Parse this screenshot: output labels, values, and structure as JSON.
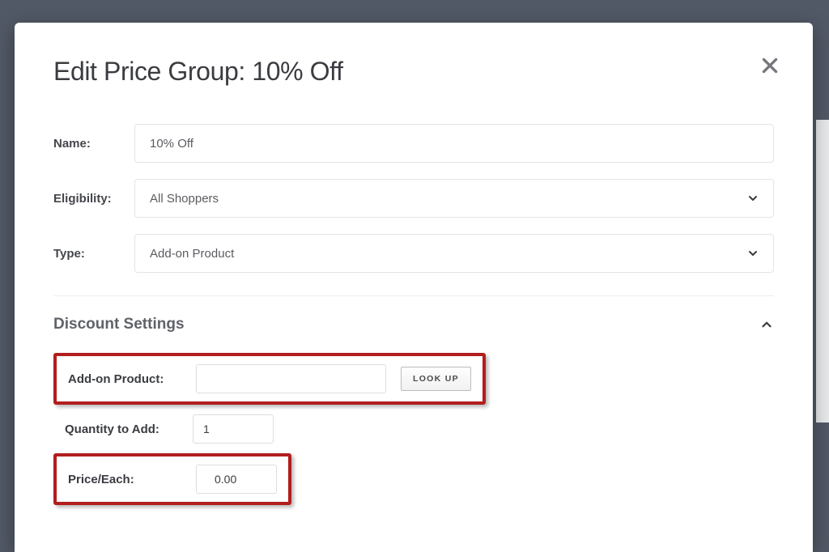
{
  "modal": {
    "title": "Edit Price Group: 10% Off"
  },
  "fields": {
    "name_label": "Name:",
    "name_value": "10% Off",
    "eligibility_label": "Eligibility:",
    "eligibility_value": "All Shoppers",
    "type_label": "Type:",
    "type_value": "Add-on Product"
  },
  "section": {
    "title": "Discount Settings"
  },
  "settings": {
    "addon_label": "Add-on Product:",
    "addon_value": "",
    "lookup_label": "LOOK UP",
    "quantity_label": "Quantity to Add:",
    "quantity_value": "1",
    "price_label": "Price/Each:",
    "price_value": "0.00"
  }
}
